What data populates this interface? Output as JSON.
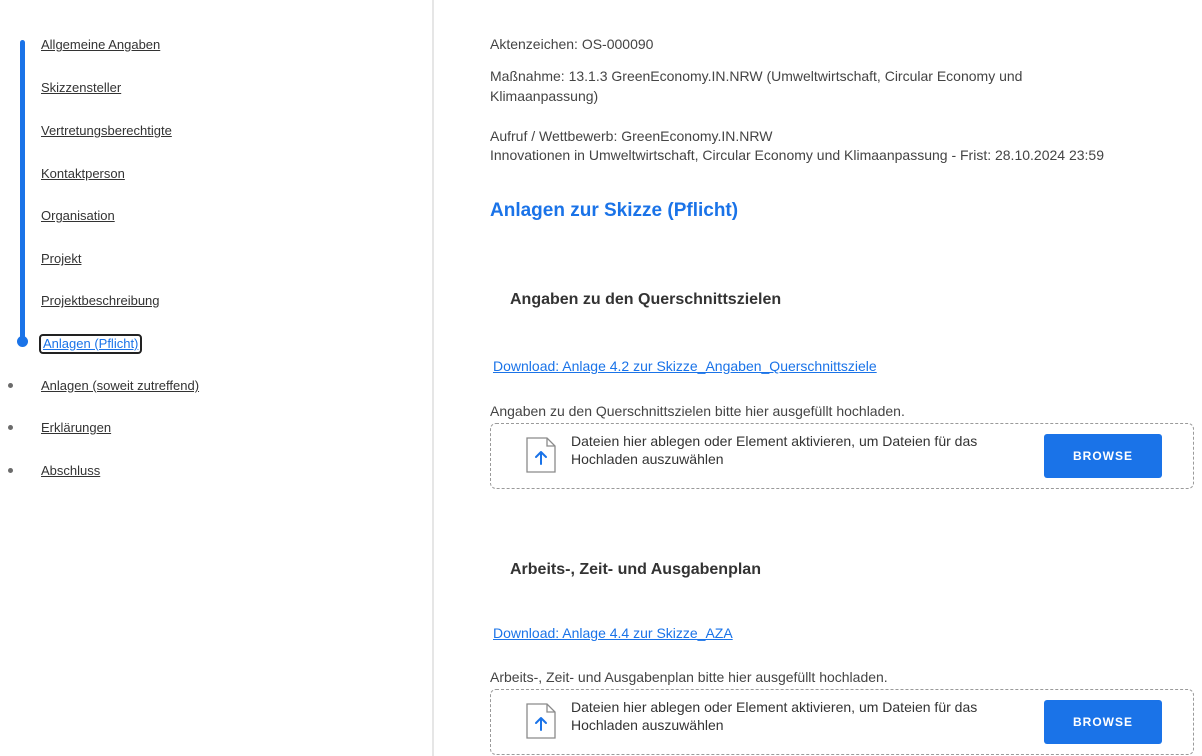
{
  "sidebar": {
    "items": [
      {
        "label": "Allgemeine Angaben"
      },
      {
        "label": "Skizzensteller"
      },
      {
        "label": "Vertretungsberechtigte"
      },
      {
        "label": "Kontaktperson"
      },
      {
        "label": "Organisation"
      },
      {
        "label": "Projekt"
      },
      {
        "label": "Projektbeschreibung"
      },
      {
        "label": "Anlagen (Pflicht)"
      },
      {
        "label": "Anlagen (soweit zutreffend)"
      },
      {
        "label": "Erklärungen"
      },
      {
        "label": "Abschluss"
      }
    ],
    "active_index": 7,
    "accent_color": "#1a73e8"
  },
  "header": {
    "aktenzeichen": "Aktenzeichen: OS-000090",
    "massnahme_line1": "Maßnahme: 13.1.3 GreenEconomy.IN.NRW (Umweltwirtschaft, Circular Economy und",
    "massnahme_line2": "Klimaanpassung)",
    "aufruf_line1": "Aufruf / Wettbewerb: GreenEconomy.IN.NRW",
    "aufruf_line2": "Innovationen in Umweltwirtschaft, Circular Economy und Klimaanpassung - Frist: 28.10.2024 23:59"
  },
  "main": {
    "section_title": "Anlagen zur Skizze (Pflicht)",
    "attachments": [
      {
        "title": "Angaben zu den Querschnittszielen",
        "download_label": "Download: Anlage 4.2 zur Skizze_Angaben_Querschnittsziele",
        "hint": "Angaben zu den Querschnittszielen bitte hier ausgefüllt hochladen.",
        "dropzone_text": "Dateien hier ablegen oder Element aktivieren, um Dateien für das Hochladen auszuwählen",
        "browse_label": "BROWSE"
      },
      {
        "title": "Arbeits-, Zeit- und Ausgabenplan",
        "download_label": "Download: Anlage 4.4 zur Skizze_AZA",
        "hint": "Arbeits-, Zeit- und Ausgabenplan bitte hier ausgefüllt hochladen.",
        "dropzone_text": "Dateien hier ablegen oder Element aktivieren, um Dateien für das Hochladen auszuwählen",
        "browse_label": "BROWSE"
      }
    ]
  },
  "icons": {
    "upload": "file-upload-icon"
  }
}
